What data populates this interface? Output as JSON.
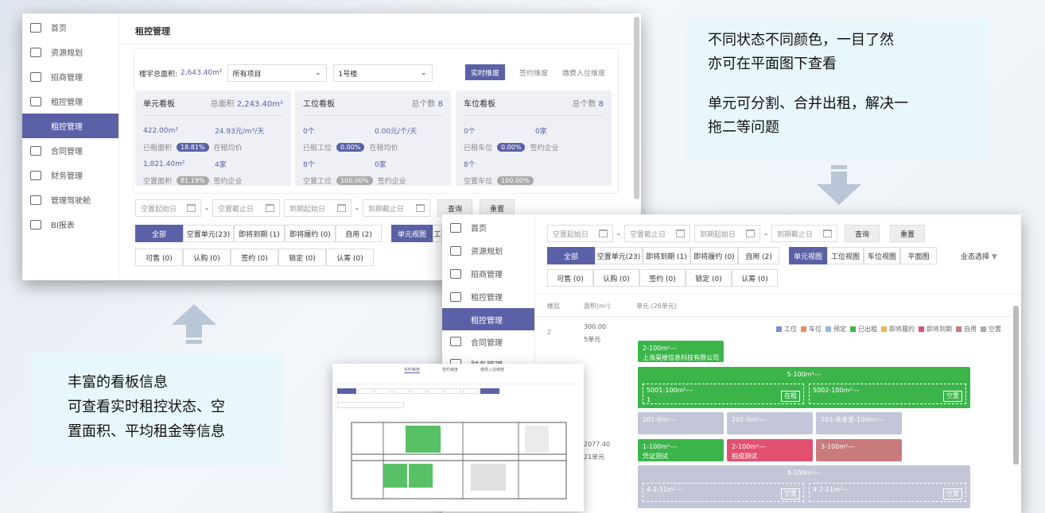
{
  "win1": {
    "sidebar": [
      "首页",
      "资源规划",
      "招商管理",
      "租控管理",
      "租控管理",
      "合同管理",
      "财务管理",
      "管理驾驶舱",
      "BI报表"
    ],
    "title": "租控管理",
    "filter": {
      "area_label": "楼宇总面积:",
      "area_value": "2,643.40m²",
      "project": "所有项目",
      "building": "1号楼"
    },
    "tabs": [
      "实时维度",
      "签约维度",
      "缴费入住维度"
    ],
    "cards": [
      {
        "title": "单元看板",
        "right_label": "总面积",
        "right_value": "2,243.40m²",
        "r1": [
          "422.00m²",
          "24.93元/m²/天"
        ],
        "r2": [
          "已租面积",
          "18.81%",
          "在租均价"
        ],
        "r3": [
          "1,821.40m²",
          "4家"
        ],
        "r4": [
          "空置面积",
          "81.19%",
          "签约企业"
        ]
      },
      {
        "title": "工位看板",
        "right_label": "总个数",
        "right_value": "8",
        "r1": [
          "0个",
          "0.00元/个/天"
        ],
        "r2": [
          "已租工位",
          "0.00%",
          "在租均价"
        ],
        "r3": [
          "8个",
          "0家"
        ],
        "r4": [
          "空置工位",
          "100.00%",
          "签约企业"
        ]
      },
      {
        "title": "车位看板",
        "right_label": "总个数",
        "right_value": "8",
        "r1": [
          "0个",
          "0家"
        ],
        "r2": [
          "已租车位",
          "0.00%",
          "签约企业"
        ],
        "r3": [
          "8个",
          ""
        ],
        "r4": [
          "空置车位",
          "100.00%",
          ""
        ]
      }
    ],
    "dates": [
      "空置起始日",
      "空置截止日",
      "到期起始日",
      "到期截止日"
    ],
    "query": "查询",
    "reset": "重置",
    "status_btns": [
      "全部",
      "空置单元(23)",
      "即将到期 (1)",
      "即将履约 (0)",
      "自用 (2)"
    ],
    "view_btn": "单元视图",
    "view_more": "工",
    "sale_btns": [
      "可售 (0)",
      "认购 (0)",
      "签约 (0)",
      "锁定 (0)",
      "认筹 (0)"
    ]
  },
  "win2": {
    "sidebar": [
      "首页",
      "资源规划",
      "招商管理",
      "租控管理",
      "租控管理",
      "合同管理",
      "财务管理"
    ],
    "dates": [
      "空置起始日",
      "空置截止日",
      "到期起始日",
      "到期截止日"
    ],
    "query": "查询",
    "reset": "重置",
    "status_btns": [
      "全部",
      "空置单元(23)",
      "即将到期 (1)",
      "即将履约 (0)",
      "自用 (2)"
    ],
    "views": [
      "单元视图",
      "工位视图",
      "车位视图",
      "平面图"
    ],
    "biz_select": "业态选择",
    "sale_btns": [
      "可售 (0)",
      "认购 (0)",
      "签约 (0)",
      "锁定 (0)",
      "认筹 (0)"
    ],
    "cols": [
      "楼层",
      "面积(m²)",
      "单元 (26单元)"
    ],
    "floor2": {
      "floor": "2",
      "area": "300.00",
      "units": "5单元"
    },
    "floor1": {
      "area": "2077.40",
      "units": "21单元"
    },
    "legend": [
      "工位",
      "车位",
      "预定",
      "已出租",
      "即将履约",
      "即将到期",
      "自用",
      "空置"
    ],
    "legend_colors": [
      "#7b8fd6",
      "#f08a5d",
      "#8fb7e3",
      "#3bb54a",
      "#f2b25c",
      "#e25070",
      "#c97a7a",
      "#aaa"
    ],
    "units": {
      "u1": "2-100m²---",
      "u1b": "上海昊楼信息科技有限公司",
      "u2": "5-100m²---",
      "u3": "5001-100m²---",
      "u3b": "1",
      "u3tag": "在租",
      "u4": "5002-100m²---",
      "u4tag": "空置",
      "u5": "201-0m²---",
      "u6": "202-0m²---",
      "u7": "203-未来里-100m²---",
      "u8": "1-100m²---",
      "u8b": "凭证测试",
      "u9": "2-100m²---",
      "u9b": "拍成测试",
      "u10": "3-100m²---",
      "u11": "4-100m²---",
      "u12": "4-1-11m²---",
      "u12tag": "空置",
      "u13": "4-2-11m²---",
      "u13tag": "空置"
    }
  },
  "win3": {
    "tabs": [
      "实时维度",
      "签约维度",
      "缴费入住维度"
    ]
  },
  "notes": {
    "top": [
      "不同状态不同颜色，一目了然",
      "亦可在平面图下查看",
      "",
      "单元可分割、合并出租，解决一",
      "拖二等问题"
    ],
    "bottom": [
      "丰富的看板信息",
      "可查看实时租控状态、空",
      "置面积、平均租金等信息"
    ]
  }
}
